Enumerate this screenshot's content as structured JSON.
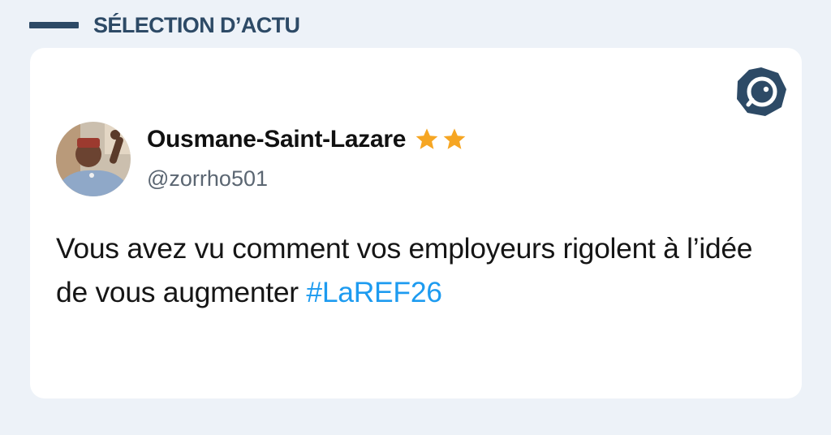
{
  "section": {
    "title": "SÉLECTION D’ACTU"
  },
  "tweet": {
    "display_name": "Ousmane-Saint-Lazare",
    "badges": [
      "star-icon",
      "star-icon"
    ],
    "handle": "@zorrho501",
    "text": "Vous avez vu comment vos employeurs rigolent à l’idée de vous augmenter ",
    "hashtag": "#LaREF26"
  },
  "colors": {
    "page_background": "#edf2f8",
    "header": "#2d4a66",
    "hashtag": "#1d9bf0",
    "star": "#f6a623"
  }
}
